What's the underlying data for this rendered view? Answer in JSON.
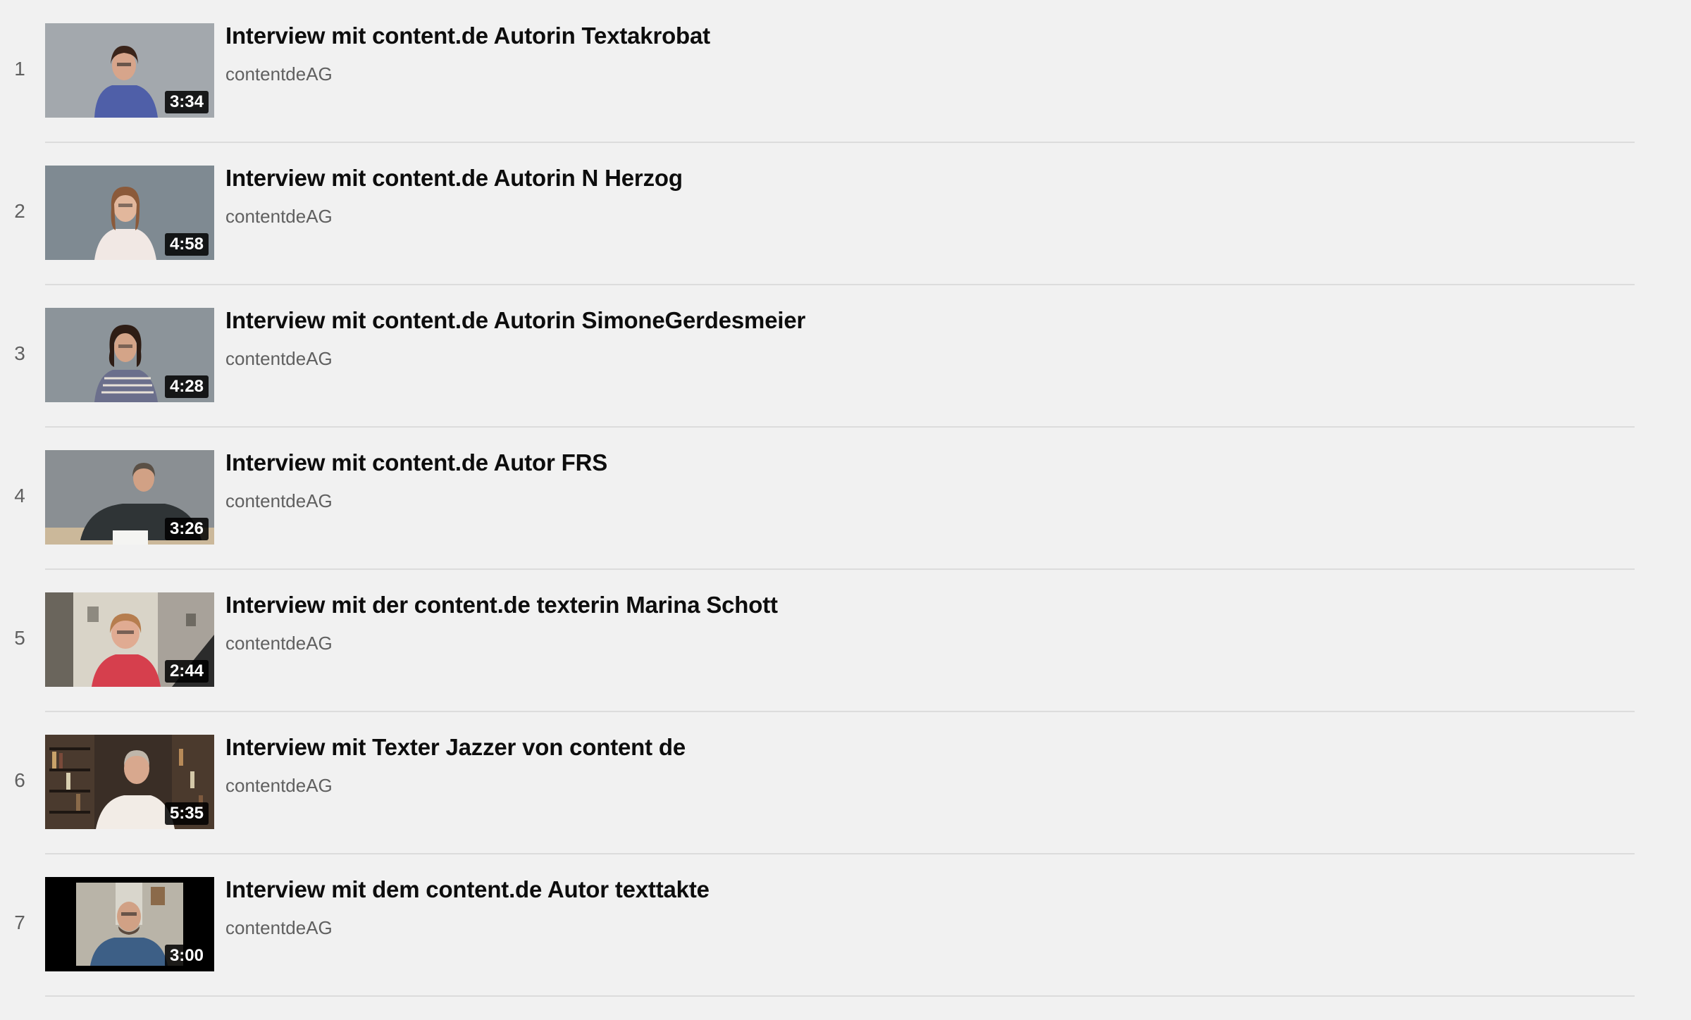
{
  "playlist": {
    "items": [
      {
        "index": "1",
        "title": "Interview mit content.de Autorin Textakrobat",
        "channel": "contentdeAG",
        "duration": "3:34",
        "thumbnail": "woman-blue-shirt-grey-wall"
      },
      {
        "index": "2",
        "title": "Interview mit content.de Autorin N Herzog",
        "channel": "contentdeAG",
        "duration": "4:58",
        "thumbnail": "woman-white-blouse-grey-wall"
      },
      {
        "index": "3",
        "title": "Interview mit content.de Autorin SimoneGerdesmeier",
        "channel": "contentdeAG",
        "duration": "4:28",
        "thumbnail": "woman-patterned-top-grey-wall"
      },
      {
        "index": "4",
        "title": "Interview mit content.de Autor FRS",
        "channel": "contentdeAG",
        "duration": "3:26",
        "thumbnail": "man-dark-shirt-at-desk"
      },
      {
        "index": "5",
        "title": "Interview mit der content.de texterin Marina Schott",
        "channel": "contentdeAG",
        "duration": "2:44",
        "thumbnail": "woman-red-top-office"
      },
      {
        "index": "6",
        "title": "Interview mit Texter Jazzer von content de",
        "channel": "contentdeAG",
        "duration": "5:35",
        "thumbnail": "man-white-shirt-bookshelf"
      },
      {
        "index": "7",
        "title": "Interview mit dem content.de Autor texttakte",
        "channel": "contentdeAG",
        "duration": "3:00",
        "thumbnail": "man-webcam-letterbox"
      }
    ]
  },
  "colors": {
    "background": "#f1f1f1",
    "title_text": "#0d0d0d",
    "meta_text": "#606060",
    "divider": "#dcdcdc",
    "duration_badge": "#000000"
  }
}
